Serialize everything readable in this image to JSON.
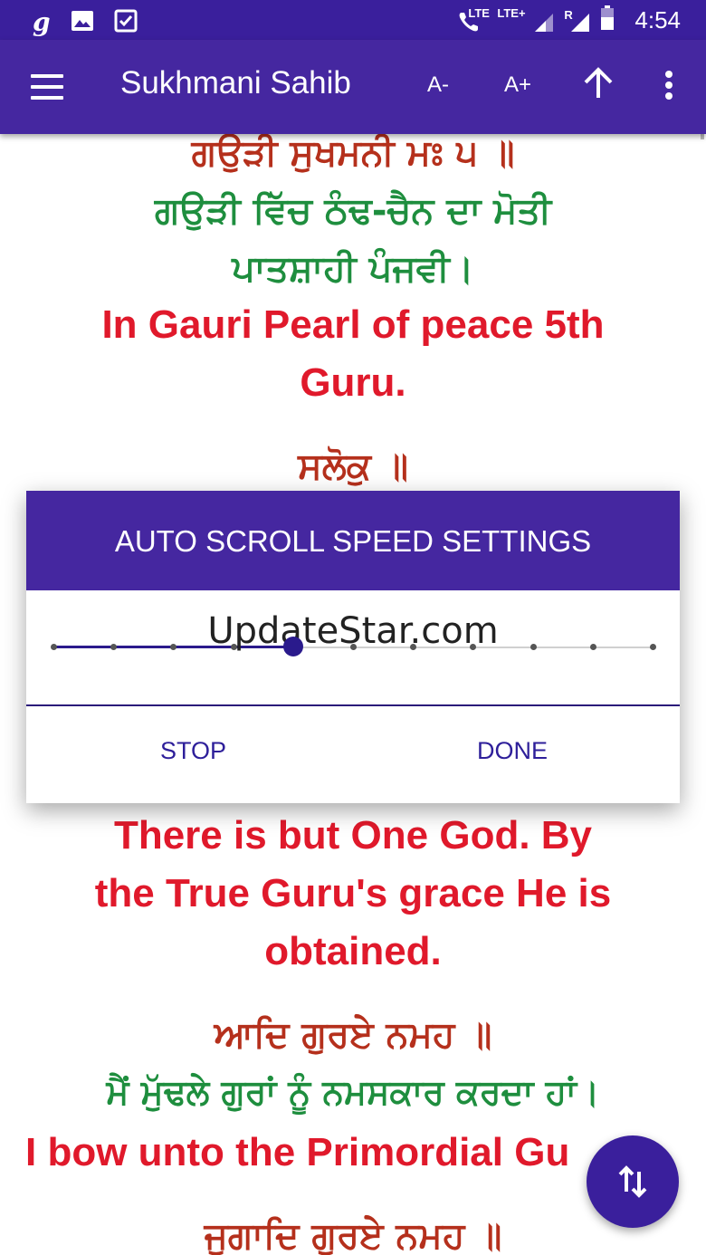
{
  "status_bar": {
    "time": "4:54",
    "lte1": "LTE",
    "lte2": "LTE+",
    "roaming": "R",
    "icons": [
      "goibibo-icon",
      "image-icon",
      "checkbox-icon",
      "wifi-call-icon",
      "signal-icon",
      "battery-icon"
    ]
  },
  "app_bar": {
    "title": "Sukhmani Sahib",
    "font_decrease": "A-",
    "font_increase": "A+",
    "icons": [
      "menu-icon",
      "scroll-up-icon",
      "more-vert-icon"
    ]
  },
  "content": {
    "lines": [
      {
        "text": "ਗਉੜੀ ਸੁਖਮਨੀ ਮਃ ੫ ॥",
        "color": "#b5301c",
        "script": "gurmukhi"
      },
      {
        "text": "ਗਉੜੀ ਵਿੱਚ ਠੰਢ-ਚੈਨ ਦਾ ਮੋਤੀ",
        "color": "#1e8e3e",
        "script": "gurmukhi"
      },
      {
        "text": "ਪਾਤਸ਼ਾਹੀ ਪੰਜਵੀ।",
        "color": "#1e8e3e",
        "script": "gurmukhi"
      },
      {
        "text": "In Gauri Pearl of peace 5th",
        "color": "#e0192b",
        "script": "latin"
      },
      {
        "text": "Guru.",
        "color": "#e0192b",
        "script": "latin"
      },
      {
        "text": "ਸਲੋਕੁ ॥",
        "color": "#b5301c",
        "script": "gurmukhi"
      },
      {
        "text": "There is but One God. By",
        "color": "#e0192b",
        "script": "latin"
      },
      {
        "text": "the True Guru's grace He is",
        "color": "#e0192b",
        "script": "latin"
      },
      {
        "text": "obtained.",
        "color": "#e0192b",
        "script": "latin"
      },
      {
        "text": "ਆਦਿ ਗੁਰਏ ਨਮਹ ॥",
        "color": "#b5301c",
        "script": "gurmukhi"
      },
      {
        "text": "ਮੈਂ ਮੁੱਢਲੇ ਗੁਰਾਂ ਨੂੰ ਨਮਸਕਾਰ ਕਰਦਾ ਹਾਂ।",
        "color": "#1e8e3e",
        "script": "gurmukhi"
      },
      {
        "text": "I bow unto the Primordial Gu",
        "color": "#e0192b",
        "script": "latin"
      },
      {
        "text": "ਜੁਗਾਦਿ ਗੁਰਏ ਨਮਹ ॥",
        "color": "#b5301c",
        "script": "gurmukhi"
      }
    ]
  },
  "dialog": {
    "title": "AUTO SCROLL SPEED SETTINGS",
    "slider": {
      "steps": 11,
      "value_index": 4
    },
    "watermark": "UpdateStar.com",
    "stop_label": "STOP",
    "done_label": "DONE"
  },
  "fab": {
    "icon": "swap-vert-icon"
  },
  "colors": {
    "primary": "#4527a0",
    "status_bar": "#3a1f9c",
    "accent": "#2a1a8c"
  }
}
